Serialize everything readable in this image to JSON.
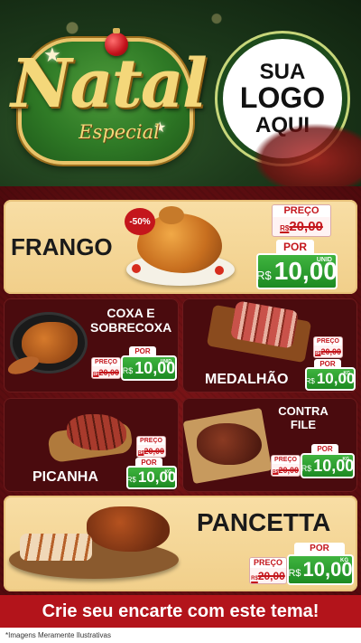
{
  "header": {
    "title_main": "Natal",
    "title_sub": "Especial",
    "logo": {
      "line1": "SUA",
      "line2": "LOGO",
      "line3": "AQUI"
    }
  },
  "products": {
    "frango": {
      "name": "FRANGO",
      "discount": "-50%",
      "preco_label": "PREÇO",
      "old_price": "R$20,00",
      "old_currency": "R$",
      "old_value": "20,00",
      "por_label": "POR",
      "currency": "R$",
      "price": "10,00",
      "unit": "UNID"
    },
    "coxa": {
      "name_line1": "COXA E",
      "name_line2": "SOBRECOXA",
      "preco_label": "PREÇO",
      "old_currency": "R$",
      "old_value": "20,00",
      "por_label": "POR",
      "currency": "R$",
      "price": "10,00",
      "unit": "UNID"
    },
    "medalhao": {
      "name": "MEDALHÃO",
      "preco_label": "PREÇO",
      "old_currency": "R$",
      "old_value": "20,00",
      "por_label": "POR",
      "currency": "R$",
      "price": "10,00",
      "unit": "KG"
    },
    "picanha": {
      "name": "PICANHA",
      "preco_label": "PREÇO",
      "old_currency": "R$",
      "old_value": "20,00",
      "por_label": "POR",
      "currency": "R$",
      "price": "10,00",
      "unit": "KG"
    },
    "contrafile": {
      "name_line1": "CONTRA",
      "name_line2": "FILE",
      "preco_label": "PREÇO",
      "old_currency": "R$",
      "old_value": "20,00",
      "por_label": "POR",
      "currency": "R$",
      "price": "10,00",
      "unit": "KG"
    },
    "pancetta": {
      "name": "PANCETTA",
      "preco_label": "PREÇO",
      "old_currency": "R$",
      "old_value": "20,00",
      "por_label": "POR",
      "currency": "R$",
      "price": "10,00",
      "unit": "KG"
    }
  },
  "banner": {
    "text": "Crie seu encarte com este tema!"
  },
  "footer": {
    "disclaimer": "*Imagens Meramente Ilustrativas"
  },
  "colors": {
    "brand_red": "#c4161c",
    "price_green": "#1d8a22",
    "cream": "#f8dea5",
    "dark_card": "#4a0b0e"
  }
}
